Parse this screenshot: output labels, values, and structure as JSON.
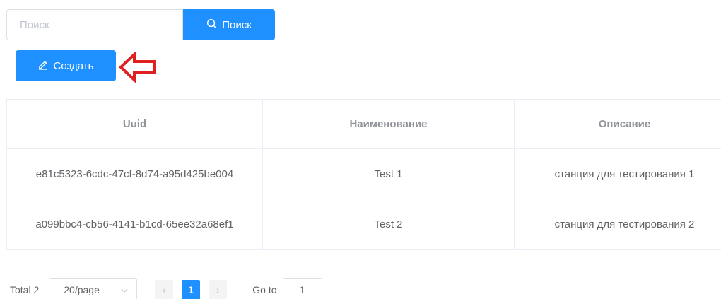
{
  "search": {
    "placeholder": "Поиск",
    "value": "",
    "button_label": "Поиск",
    "button_icon": "search-icon"
  },
  "create": {
    "label": "Создать",
    "icon": "edit-icon"
  },
  "annotation": {
    "arrow_color": "#e02020",
    "arrow_icon": "left-arrow-outline-icon"
  },
  "colors": {
    "primary": "#1e90ff",
    "border": "#ebeef5",
    "header_text": "#909399",
    "body_text": "#606266"
  },
  "table": {
    "columns": [
      "Uuid",
      "Наименование",
      "Описание"
    ],
    "rows": [
      [
        "e81c5323-6cdc-47cf-8d74-a95d425be004",
        "Test 1",
        "станция для тестирования 1"
      ],
      [
        "a099bbc4-cb56-4141-b1cd-65ee32a68ef1",
        "Test 2",
        "станция для тестирования 2"
      ]
    ]
  },
  "pagination": {
    "total_label": "Total 2",
    "page_size": "20/page",
    "prev": "‹",
    "current_page": "1",
    "next": "›",
    "goto_label": "Go to",
    "goto_value": "1"
  }
}
